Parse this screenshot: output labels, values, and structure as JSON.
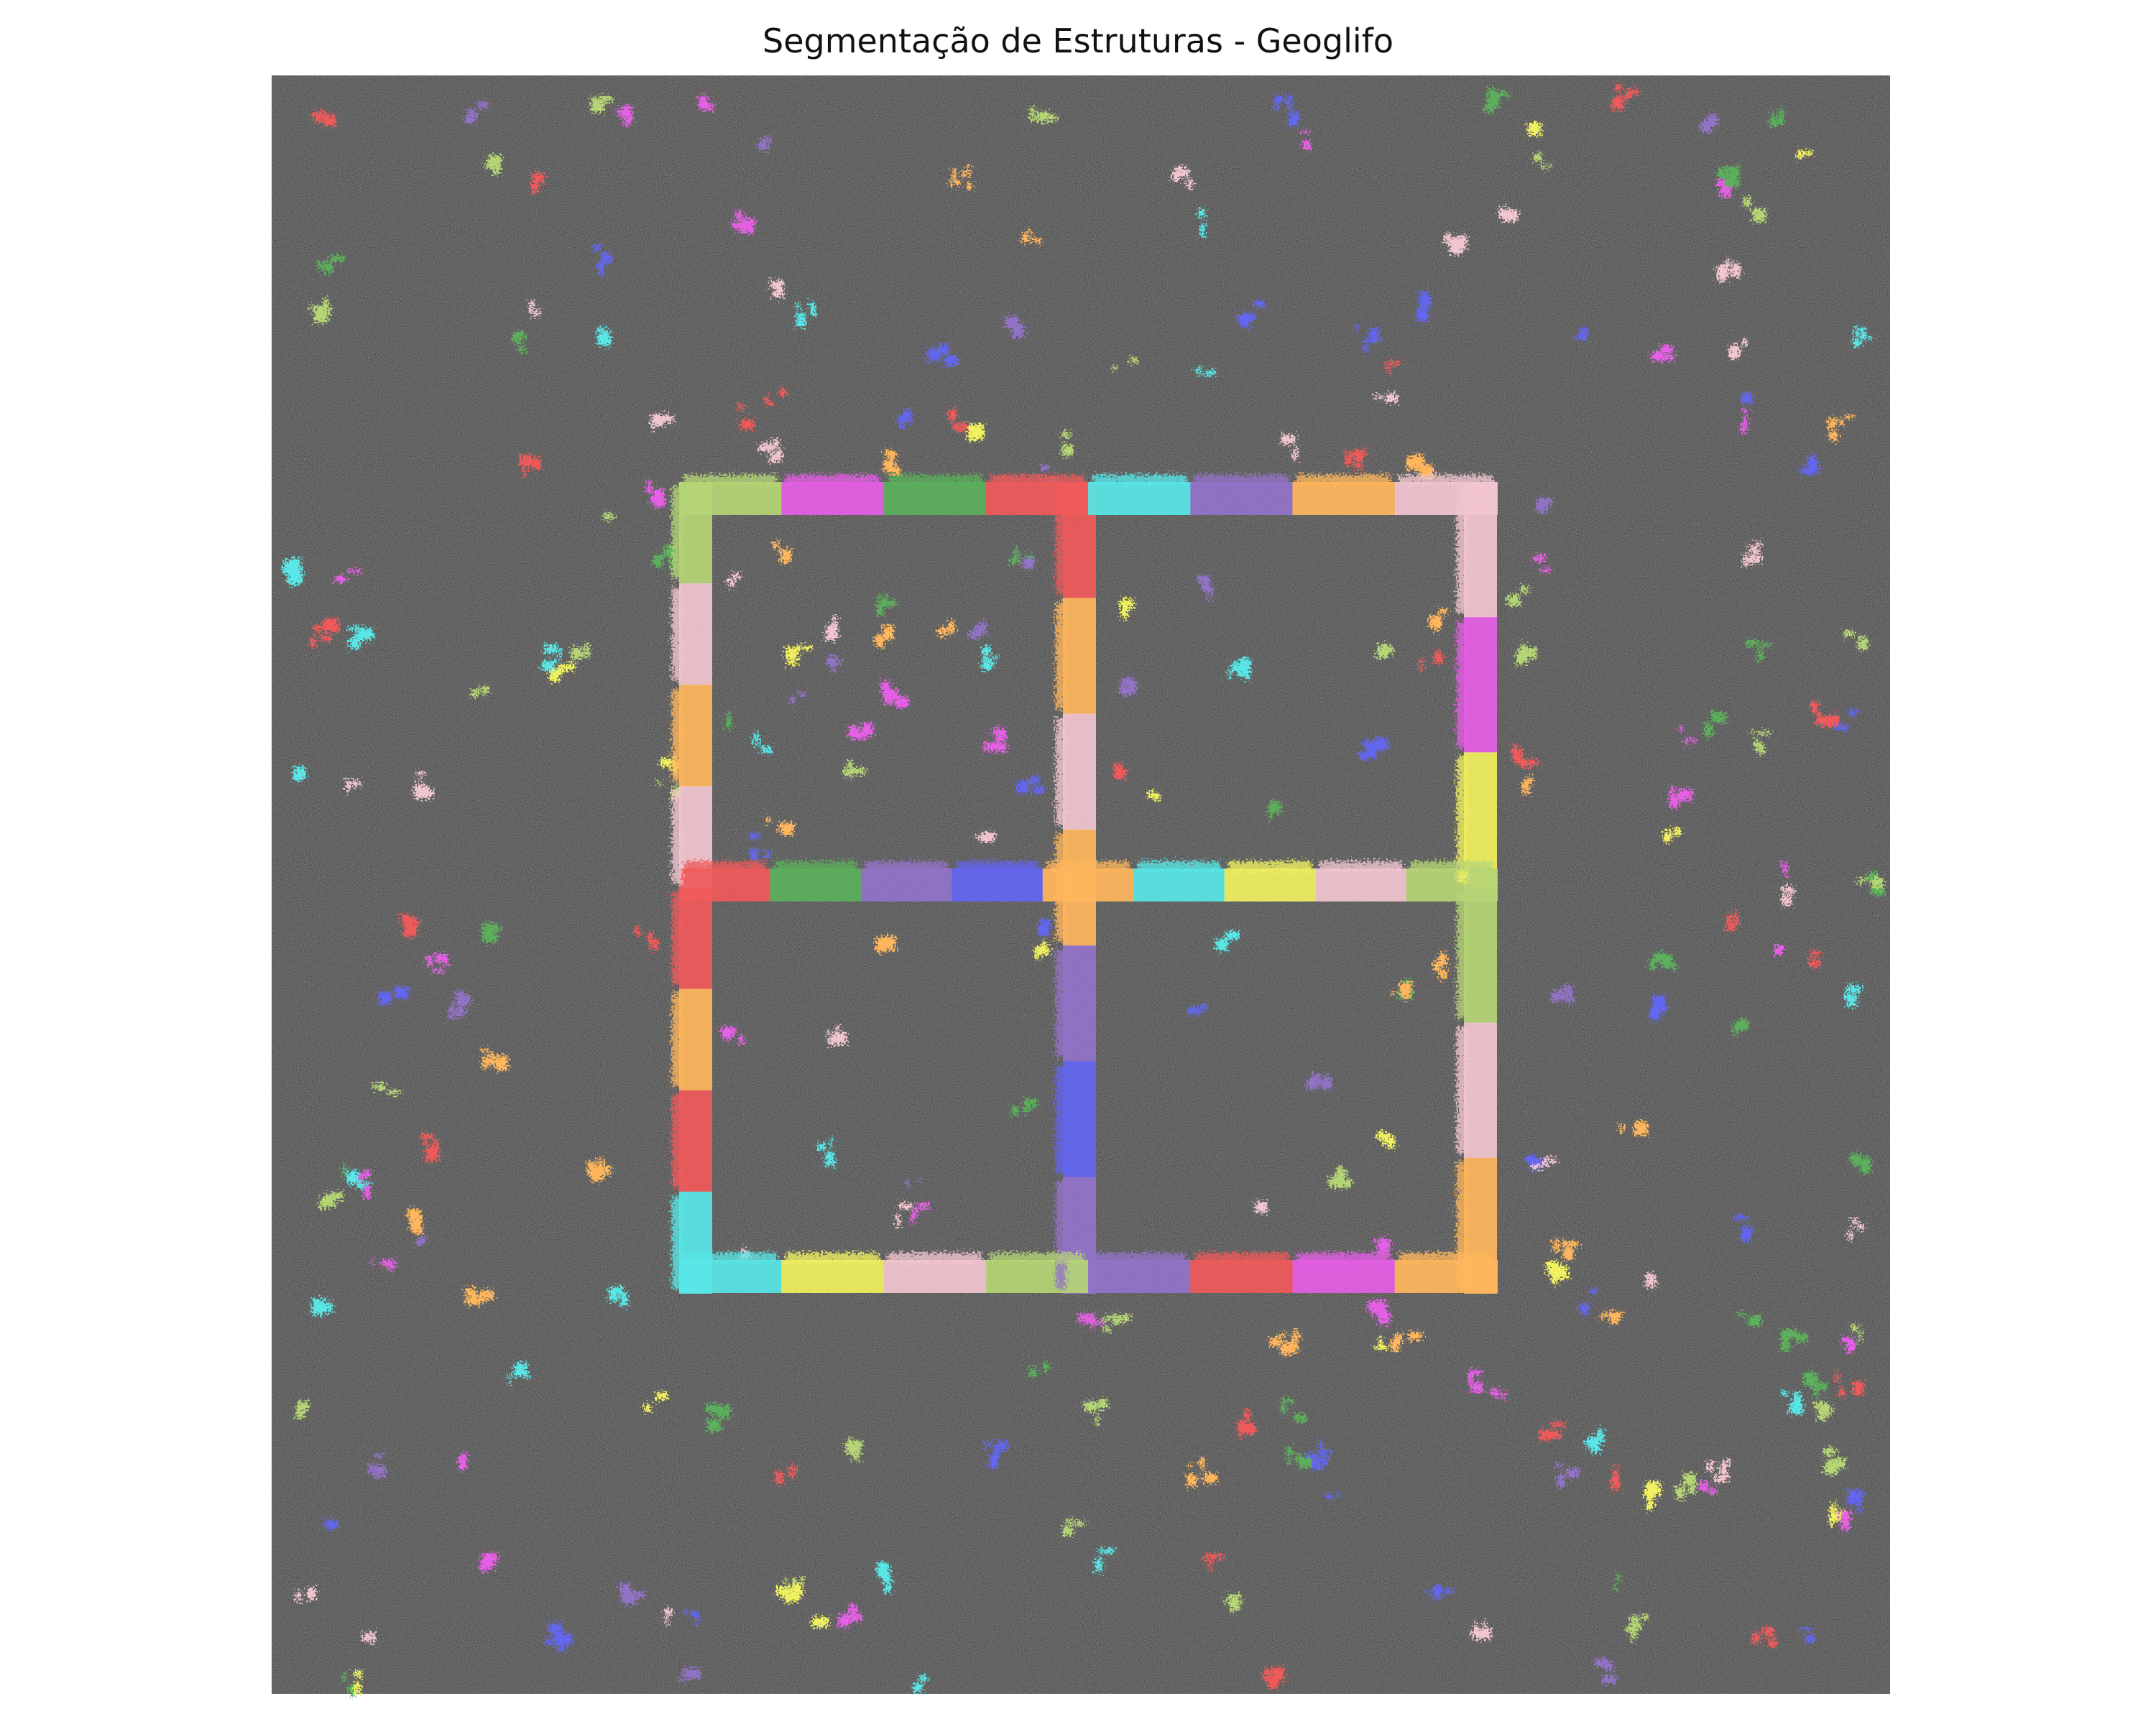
{
  "title": "Segmentação de Estruturas - Geoglifo",
  "colors": {
    "background": "#ffffff",
    "terrain": "#474747",
    "palette": [
      "#f05a5a",
      "#e65ee6",
      "#5bb05b",
      "#b5d575",
      "#ffb65c",
      "#f2c6cf",
      "#58e6e6",
      "#9373c9",
      "#6366f2",
      "#f0f060"
    ]
  },
  "glyph_segments": {
    "top": [
      "#b5d575",
      "#e65ee6",
      "#5bb05b",
      "#f05a5a",
      "#58e6e6",
      "#9373c9",
      "#ffb65c",
      "#f2c6cf"
    ],
    "bottom": [
      "#58e6e6",
      "#f0f060",
      "#f2c6cf",
      "#b5d575",
      "#9373c9",
      "#f05a5a",
      "#e65ee6",
      "#ffb65c"
    ],
    "left": [
      "#b5d575",
      "#f2c6cf",
      "#ffb65c",
      "#f2c6cf",
      "#f05a5a",
      "#ffb65c",
      "#f05a5a",
      "#58e6e6"
    ],
    "right": [
      "#f2c6cf",
      "#e65ee6",
      "#f0f060",
      "#b5d575",
      "#f2c6cf",
      "#ffb65c"
    ],
    "middle_horizontal": [
      "#f05a5a",
      "#5bb05b",
      "#9373c9",
      "#6366f2",
      "#ffb65c",
      "#58e6e6",
      "#f0f060",
      "#f2c6cf",
      "#b5d575"
    ],
    "middle_vertical": [
      "#f05a5a",
      "#ffb65c",
      "#f2c6cf",
      "#ffb65c",
      "#9373c9",
      "#6366f2",
      "#9373c9"
    ]
  }
}
